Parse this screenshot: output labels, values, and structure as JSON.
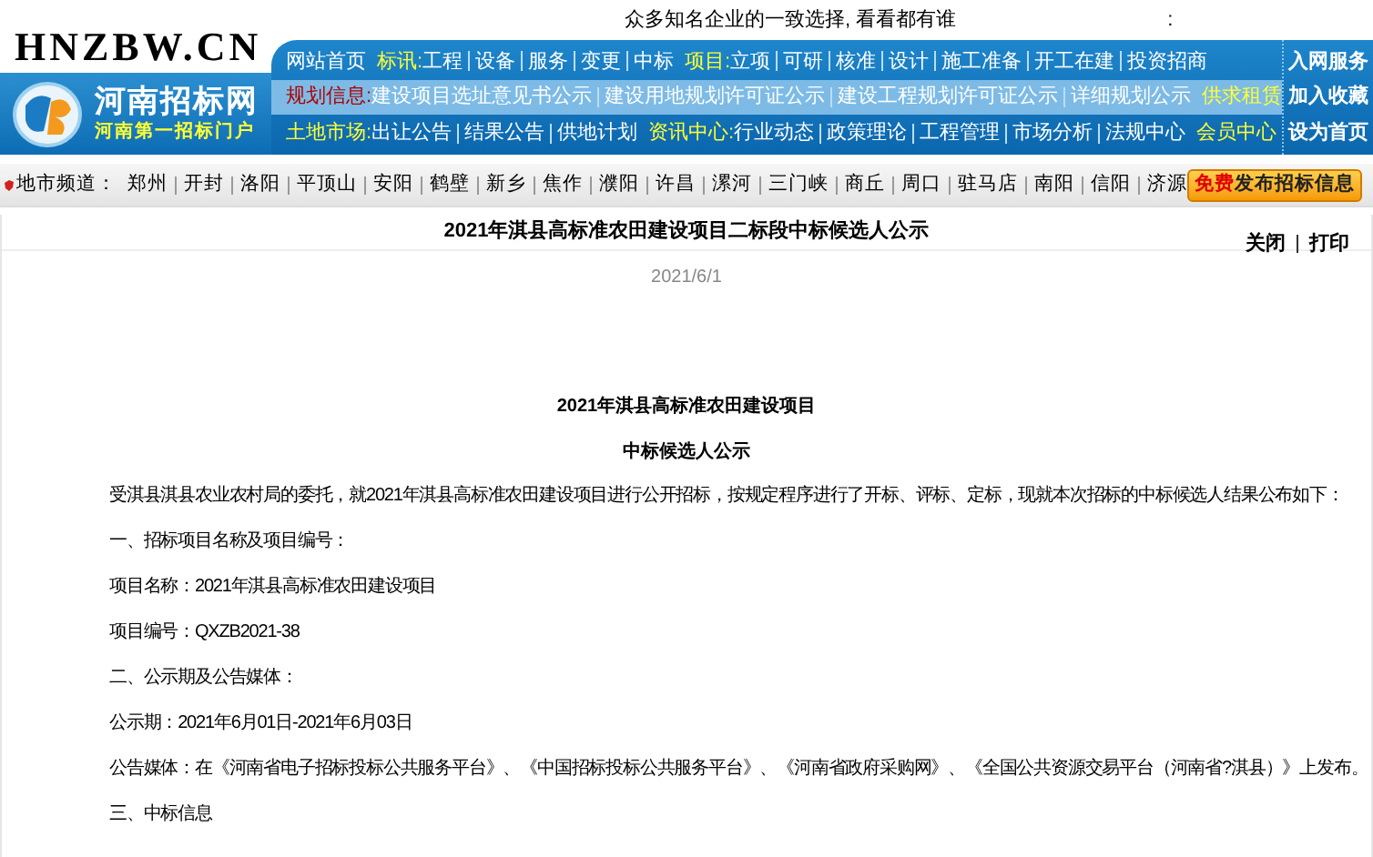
{
  "top_bar": {
    "slogan": "众多知名企业的一致选择, 看看都有谁",
    "mark": ":"
  },
  "logo": {
    "domain": "HNZBW.CN",
    "name": "河南招标网",
    "tagline": "河南第一招标门户"
  },
  "nav_rows": [
    {
      "highlighted": false,
      "items": [
        {
          "text": "网站首页",
          "kind": "link"
        },
        {
          "text": "标讯:",
          "kind": "label"
        },
        {
          "text": "工程",
          "kind": "link"
        },
        {
          "text": "设备",
          "kind": "link"
        },
        {
          "text": "服务",
          "kind": "link"
        },
        {
          "text": "变更",
          "kind": "link"
        },
        {
          "text": "中标",
          "kind": "link"
        },
        {
          "text": "项目:",
          "kind": "label"
        },
        {
          "text": "立项",
          "kind": "link"
        },
        {
          "text": "可研",
          "kind": "link"
        },
        {
          "text": "核准",
          "kind": "link"
        },
        {
          "text": "设计",
          "kind": "link"
        },
        {
          "text": "施工准备",
          "kind": "link"
        },
        {
          "text": "开工在建",
          "kind": "link"
        },
        {
          "text": "投资招商",
          "kind": "link"
        }
      ]
    },
    {
      "highlighted": true,
      "items": [
        {
          "text": "规划信息:",
          "kind": "alert"
        },
        {
          "text": "建设项目选址意见书公示",
          "kind": "link"
        },
        {
          "text": "建设用地规划许可证公示",
          "kind": "link"
        },
        {
          "text": "建设工程规划许可证公示",
          "kind": "link"
        },
        {
          "text": "详细规划公示",
          "kind": "link"
        },
        {
          "text": "供求租赁",
          "kind": "label"
        }
      ]
    },
    {
      "highlighted": false,
      "items": [
        {
          "text": "土地市场:",
          "kind": "label"
        },
        {
          "text": "出让公告",
          "kind": "link"
        },
        {
          "text": "结果公告",
          "kind": "link"
        },
        {
          "text": "供地计划",
          "kind": "link"
        },
        {
          "text": "资讯中心:",
          "kind": "label"
        },
        {
          "text": "行业动态",
          "kind": "link"
        },
        {
          "text": "政策理论",
          "kind": "link"
        },
        {
          "text": "工程管理",
          "kind": "link"
        },
        {
          "text": "市场分析",
          "kind": "link"
        },
        {
          "text": "法规中心",
          "kind": "link"
        },
        {
          "text": "会员中心",
          "kind": "label"
        }
      ]
    }
  ],
  "side_links": [
    "入网服务",
    "加入收藏",
    "设为首页"
  ],
  "city_channel": {
    "label": "地市频道：",
    "cities": [
      "郑州",
      "开封",
      "洛阳",
      "平顶山",
      "安阳",
      "鹤壁",
      "新乡",
      "焦作",
      "濮阳",
      "许昌",
      "漯河",
      "三门峡",
      "商丘",
      "周口",
      "驻马店",
      "南阳",
      "信阳",
      "济源"
    ],
    "button": [
      {
        "text": "免费",
        "kind": "emphasis"
      },
      {
        "text": "发布招标信息",
        "kind": "plain"
      }
    ]
  },
  "article": {
    "title": "2021年淇县高标准农田建设项目二标段中标候选人公示",
    "actions": [
      "关闭",
      "打印"
    ],
    "date": "2021/6/1",
    "heading": "2021年淇县高标准农田建设项目",
    "subheading": "中标候选人公示",
    "paragraphs": [
      "受淇县淇县农业农村局的委托，就2021年淇县高标准农田建设项目进行公开招标，按规定程序进行了开标、评标、定标，现就本次招标的中标候选人结果公布如下：",
      "一、招标项目名称及项目编号：",
      "项目名称：2021年淇县高标准农田建设项目",
      "项目编号：QXZB2021-38",
      "二、公示期及公告媒体：",
      "公示期：2021年6月01日-2021年6月03日",
      "公告媒体：在《河南省电子招标投标公共服务平台》、《中国招标投标公共服务平台》、《河南省政府采购网》、《全国公共资源交易平台（河南省?淇县）》上发布。",
      "三、中标信息"
    ]
  }
}
